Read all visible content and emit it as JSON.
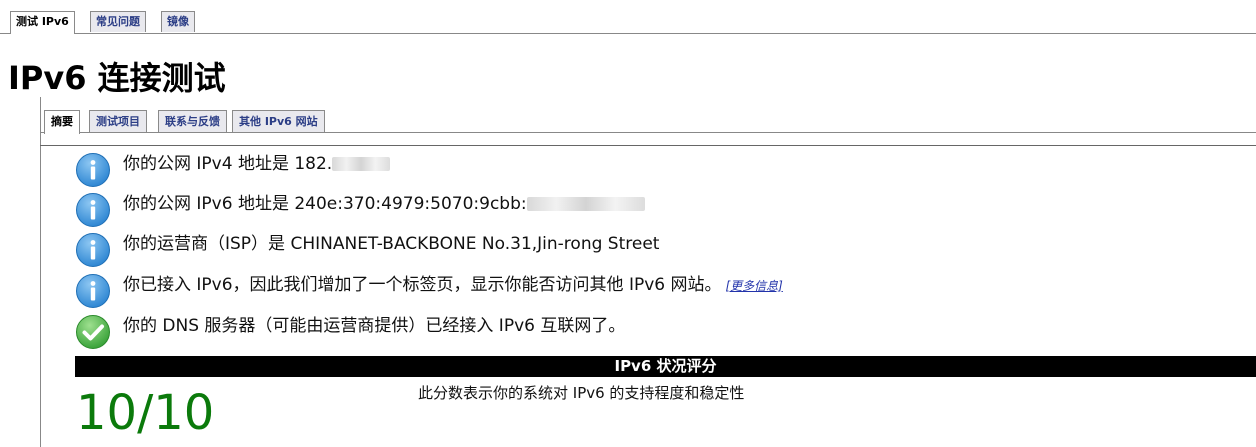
{
  "top_tabs": [
    {
      "label": "测试 IPv6",
      "active": true
    },
    {
      "label": "常见问题",
      "active": false
    },
    {
      "label": "镜像",
      "active": false
    }
  ],
  "page_title": "IPv6 连接测试",
  "sub_tabs": [
    {
      "label": "摘要",
      "active": true
    },
    {
      "label": "测试项目",
      "active": false
    },
    {
      "label": "联系与反馈",
      "active": false
    },
    {
      "label": "其他 IPv6 网站",
      "active": false
    }
  ],
  "messages": [
    {
      "icon": "info-icon",
      "text": "你的公网 IPv4 地址是 182."
    },
    {
      "icon": "info-icon",
      "text": "你的公网 IPv6 地址是 240e:370:4979:5070:9cbb:"
    },
    {
      "icon": "info-icon",
      "text": "你的运营商（ISP）是 CHINANET-BACKBONE No.31,Jin-rong Street"
    },
    {
      "icon": "info-icon",
      "text": "你已接入 IPv6，因此我们增加了一个标签页，显示你能否访问其他 IPv6 网站。",
      "link": "[更多信息]"
    },
    {
      "icon": "check-icon",
      "text": "你的 DNS 服务器（可能由运营商提供）已经接入 IPv6 互联网了。"
    }
  ],
  "score": {
    "header": "IPv6 状况评分",
    "description": "此分数表示你的系统对 IPv6 的支持程度和稳定性",
    "value": "10/10"
  },
  "colors": {
    "info_icon": "#2f87d3",
    "check_icon": "#3aa33a",
    "score_value": "#0b7a0b"
  }
}
